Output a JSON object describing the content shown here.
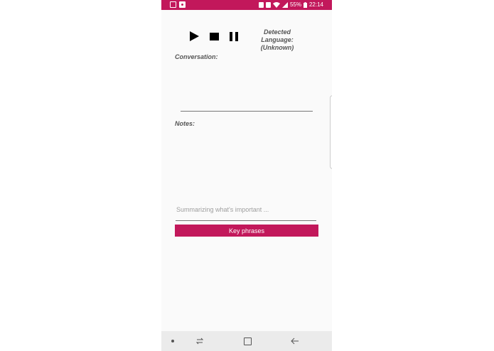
{
  "status_bar": {
    "battery": "55%",
    "time": "22:14",
    "color": "#c2185b"
  },
  "controls": {
    "play_icon": "play-icon",
    "stop_icon": "stop-icon",
    "pause_icon": "pause-icon"
  },
  "language": {
    "label": "Detected Language:",
    "value": "(Unknown)"
  },
  "conversation": {
    "label": "Conversation:"
  },
  "notes": {
    "label": "Notes:"
  },
  "summary": {
    "placeholder": "Summarizing what's important ..."
  },
  "key_phrases_button": {
    "label": "Key phrases",
    "color": "#c2185b"
  },
  "nav_bar": {
    "items": [
      "dot-icon",
      "recents-icon",
      "home-icon",
      "back-icon"
    ]
  }
}
